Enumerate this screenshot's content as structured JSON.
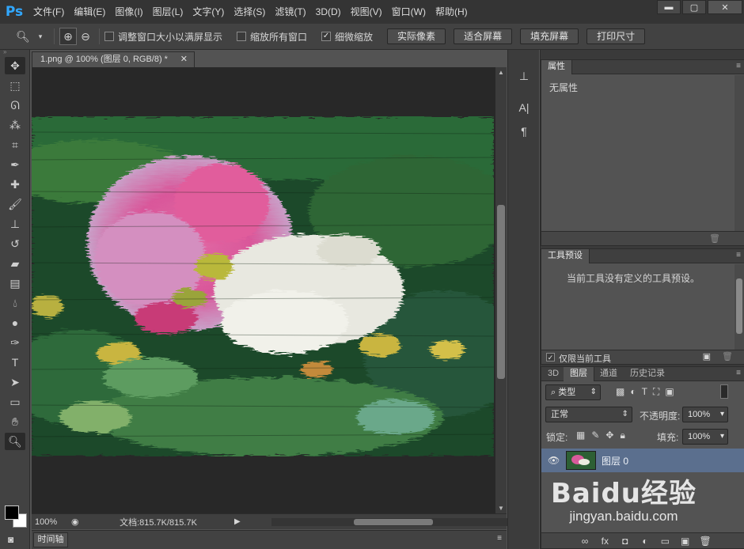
{
  "app": {
    "logo": "Ps"
  },
  "menu": [
    "文件(F)",
    "编辑(E)",
    "图像(I)",
    "图层(L)",
    "文字(Y)",
    "选择(S)",
    "滤镜(T)",
    "3D(D)",
    "视图(V)",
    "窗口(W)",
    "帮助(H)"
  ],
  "window_controls": {
    "minimize": "▬",
    "restore": "▢",
    "close": "✕"
  },
  "options": {
    "resize_windows": "调整窗口大小以满屏显示",
    "zoom_all": "缩放所有窗口",
    "scrubby_zoom": "细微缩放",
    "actual_pixels": "实际像素",
    "fit_screen": "适合屏幕",
    "fill_screen": "填充屏幕",
    "print_size": "打印尺寸"
  },
  "document": {
    "tab_title": "1.png @ 100% (图层 0, RGB/8) *",
    "zoom": "100%",
    "doc_info": "文档:815.7K/815.7K"
  },
  "timeline": {
    "label": "时间轴"
  },
  "properties": {
    "title": "属性",
    "content": "无属性"
  },
  "tool_presets": {
    "title": "工具预设",
    "content": "当前工具没有定义的工具预设。",
    "current_tool_only": "仅限当前工具"
  },
  "layers": {
    "tabs": [
      "3D",
      "图层",
      "通道",
      "历史记录"
    ],
    "filter_kind": "类型",
    "blend_mode": "正常",
    "opacity_label": "不透明度:",
    "opacity_value": "100%",
    "lock_label": "锁定:",
    "fill_label": "填充:",
    "fill_value": "100%",
    "items": [
      {
        "name": "图层 0",
        "visible": true
      }
    ],
    "footer_icons": [
      "∞",
      "fx",
      "◘",
      "◐",
      "▭",
      "▣",
      "🗑"
    ]
  },
  "watermark": {
    "brand": "Baidu经验",
    "url": "jingyan.baidu.com"
  }
}
